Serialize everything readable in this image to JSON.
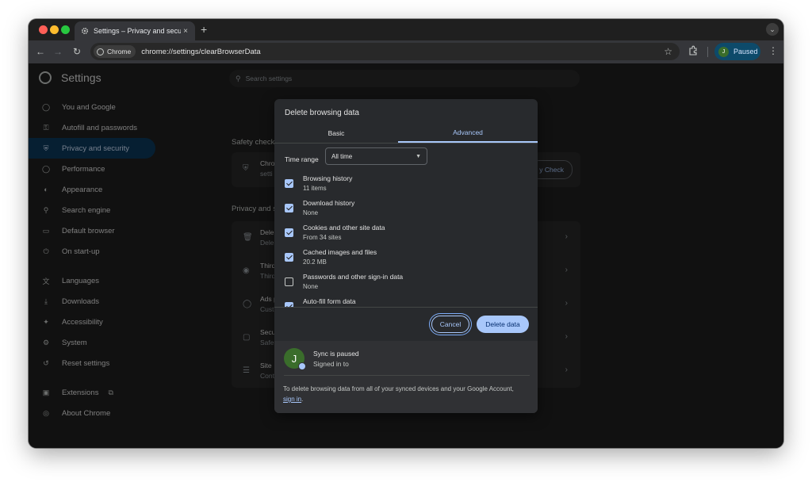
{
  "browser": {
    "tab_title": "Settings – Privacy and securi",
    "tab_close": "×",
    "new_tab": "+",
    "chip_label": "Chrome",
    "url": "chrome://settings/clearBrowserData",
    "profile_initial": "J",
    "profile_status": "Paused"
  },
  "settings": {
    "title": "Settings",
    "search_placeholder": "Search settings",
    "nav": [
      {
        "label": "You and Google",
        "icon": "person-icon"
      },
      {
        "label": "Autofill and passwords",
        "icon": "key-icon"
      },
      {
        "label": "Privacy and security",
        "icon": "shield-icon",
        "active": true
      },
      {
        "label": "Performance",
        "icon": "speedometer-icon"
      },
      {
        "label": "Appearance",
        "icon": "palette-icon"
      },
      {
        "label": "Search engine",
        "icon": "search-icon"
      },
      {
        "label": "Default browser",
        "icon": "browser-icon"
      },
      {
        "label": "On start-up",
        "icon": "power-icon"
      },
      {
        "label": "Languages",
        "icon": "translate-icon"
      },
      {
        "label": "Downloads",
        "icon": "download-icon"
      },
      {
        "label": "Accessibility",
        "icon": "accessibility-icon"
      },
      {
        "label": "System",
        "icon": "wrench-icon"
      },
      {
        "label": "Reset settings",
        "icon": "reset-icon"
      },
      {
        "label": "Extensions",
        "icon": "puzzle-icon"
      },
      {
        "label": "About Chrome",
        "icon": "chrome-icon"
      }
    ],
    "safety_check_heading": "Safety check",
    "safety_row_t1": "Chro",
    "safety_row_t2": "setti",
    "safety_button": "y Check",
    "privacy_heading": "Privacy and s",
    "privacy_rows": [
      {
        "t1": "Dele",
        "t2": "Dele",
        "icon": "trash-icon"
      },
      {
        "t1": "Third",
        "t2": "Third",
        "icon": "cookie-icon"
      },
      {
        "t1": "Ads p",
        "t2": "Cust",
        "icon": "ads-icon"
      },
      {
        "t1": "Secu",
        "t2": "Safe",
        "icon": "lock-icon"
      },
      {
        "t1": "Site",
        "t2": "Cont",
        "icon": "sliders-icon"
      }
    ]
  },
  "dialog": {
    "title": "Delete browsing data",
    "tab_basic": "Basic",
    "tab_advanced": "Advanced",
    "time_range_label": "Time range",
    "time_range_value": "All time",
    "items": [
      {
        "label": "Browsing history",
        "sub": "11 items",
        "checked": true
      },
      {
        "label": "Download history",
        "sub": "None",
        "checked": true
      },
      {
        "label": "Cookies and other site data",
        "sub": "From 34 sites",
        "checked": true
      },
      {
        "label": "Cached images and files",
        "sub": "20.2 MB",
        "checked": true
      },
      {
        "label": "Passwords and other sign-in data",
        "sub": "None",
        "checked": false
      },
      {
        "label": "Auto-fill form data",
        "sub": "",
        "checked": true
      }
    ],
    "cancel": "Cancel",
    "delete": "Delete data",
    "sync_initial": "J",
    "sync_title": "Sync is paused",
    "sync_sub": "Signed in to",
    "sync_note": "To delete browsing data from all of your synced devices and your Google Account,",
    "sync_link": "sign in",
    "sync_note_end": "."
  },
  "colors": {
    "accent": "#a8c7fa",
    "active_nav": "#0b3a5c",
    "avatar": "#3a6d2b"
  }
}
